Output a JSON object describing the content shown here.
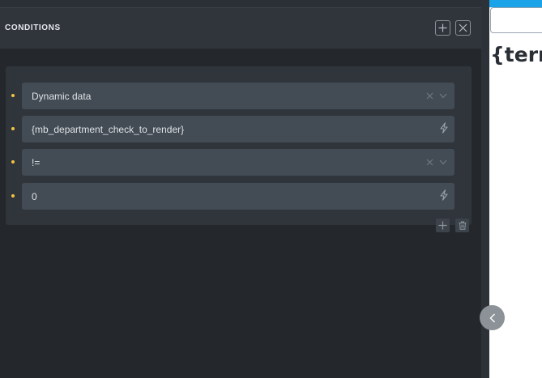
{
  "panel": {
    "title": "CONDITIONS",
    "add_icon": "plus-icon",
    "close_icon": "close-icon"
  },
  "conditions": [
    {
      "value": "Dynamic data",
      "type": "select"
    },
    {
      "value": "{mb_department_check_to_render}",
      "type": "dynamic"
    },
    {
      "value": "!=",
      "type": "select"
    },
    {
      "value": "0",
      "type": "dynamic"
    }
  ],
  "row_actions": {
    "add_icon": "plus-icon",
    "delete_icon": "trash-icon"
  },
  "canvas": {
    "text": "{term"
  },
  "colors": {
    "accent_dot": "#f3c43f",
    "canvas_bar": "#1aa3e8",
    "panel_bg": "#24282d"
  }
}
